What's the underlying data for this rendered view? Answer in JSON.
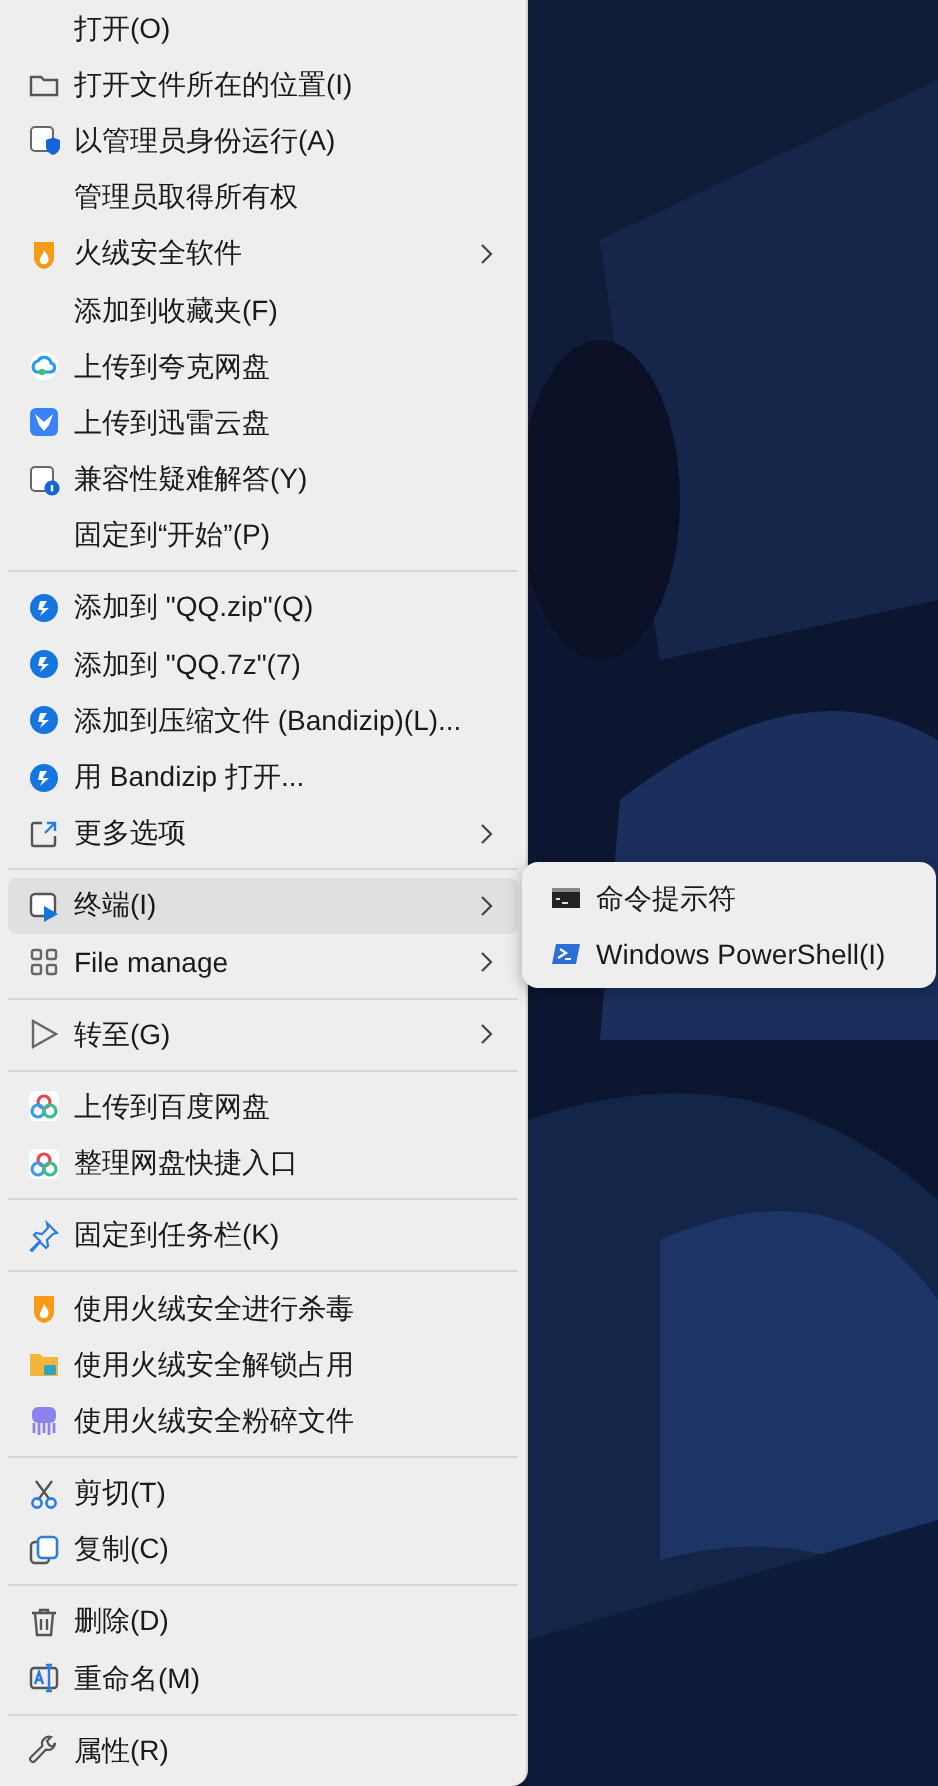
{
  "menu": {
    "groups": [
      {
        "items": [
          {
            "label": "打开(O)",
            "submenu": false,
            "selected": false
          },
          {
            "label": "打开文件所在的位置(I)",
            "submenu": false,
            "selected": false
          },
          {
            "label": "以管理员身份运行(A)",
            "submenu": false,
            "selected": false
          },
          {
            "label": "管理员取得所有权",
            "submenu": false,
            "selected": false
          },
          {
            "label": "火绒安全软件",
            "submenu": true,
            "selected": false
          },
          {
            "label": "添加到收藏夹(F)",
            "submenu": false,
            "selected": false
          },
          {
            "label": "上传到夸克网盘",
            "submenu": false,
            "selected": false
          },
          {
            "label": "上传到迅雷云盘",
            "submenu": false,
            "selected": false
          },
          {
            "label": "兼容性疑难解答(Y)",
            "submenu": false,
            "selected": false
          },
          {
            "label": "固定到“开始”(P)",
            "submenu": false,
            "selected": false
          }
        ]
      },
      {
        "items": [
          {
            "label": "添加到 \"QQ.zip\"(Q)",
            "submenu": false,
            "selected": false
          },
          {
            "label": "添加到 \"QQ.7z\"(7)",
            "submenu": false,
            "selected": false
          },
          {
            "label": "添加到压缩文件 (Bandizip)(L)...",
            "submenu": false,
            "selected": false
          },
          {
            "label": "用 Bandizip 打开...",
            "submenu": false,
            "selected": false
          },
          {
            "label": "更多选项",
            "submenu": true,
            "selected": false
          }
        ]
      },
      {
        "items": [
          {
            "label": "终端(I)",
            "submenu": true,
            "selected": true
          },
          {
            "label": "File manage",
            "submenu": true,
            "selected": false
          }
        ]
      },
      {
        "items": [
          {
            "label": "转至(G)",
            "submenu": true,
            "selected": false
          }
        ]
      },
      {
        "items": [
          {
            "label": "上传到百度网盘",
            "submenu": false,
            "selected": false
          },
          {
            "label": "整理网盘快捷入口",
            "submenu": false,
            "selected": false
          }
        ]
      },
      {
        "items": [
          {
            "label": "固定到任务栏(K)",
            "submenu": false,
            "selected": false
          }
        ]
      },
      {
        "items": [
          {
            "label": "使用火绒安全进行杀毒",
            "submenu": false,
            "selected": false
          },
          {
            "label": "使用火绒安全解锁占用",
            "submenu": false,
            "selected": false
          },
          {
            "label": "使用火绒安全粉碎文件",
            "submenu": false,
            "selected": false
          }
        ]
      },
      {
        "items": [
          {
            "label": "剪切(T)",
            "submenu": false,
            "selected": false
          },
          {
            "label": "复制(C)",
            "submenu": false,
            "selected": false
          }
        ]
      },
      {
        "items": [
          {
            "label": "删除(D)",
            "submenu": false,
            "selected": false
          },
          {
            "label": "重命名(M)",
            "submenu": false,
            "selected": false
          }
        ]
      },
      {
        "items": [
          {
            "label": "属性(R)",
            "submenu": false,
            "selected": false
          }
        ]
      }
    ]
  },
  "submenu": {
    "items": [
      {
        "label": "命令提示符",
        "selected": false
      },
      {
        "label": "Windows PowerShell(I)",
        "selected": false
      }
    ]
  }
}
